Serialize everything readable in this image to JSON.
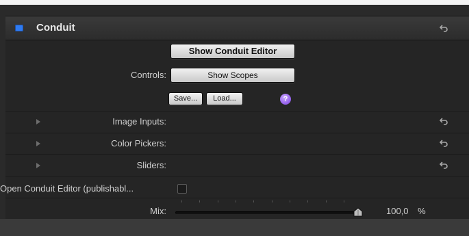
{
  "header": {
    "title": "Conduit"
  },
  "buttons": {
    "show_editor": "Show Conduit Editor",
    "show_scopes": "Show Scopes",
    "save": "Save...",
    "load": "Load...",
    "help": "?"
  },
  "labels": {
    "controls": "Controls:",
    "image_inputs": "Image Inputs:",
    "color_pickers": "Color Pickers:",
    "sliders": "Sliders:",
    "open_editor": "Open Conduit Editor (publishabl...",
    "mix": "Mix:"
  },
  "mix": {
    "value_text": "100,0",
    "unit": "%",
    "value": 100
  },
  "open_editor_checked": false,
  "colors": {
    "accent": "#2f7bf1",
    "help": "#8a4cf0"
  },
  "icons": [
    "reset-icon",
    "disclosure-triangle-icon",
    "help-icon",
    "enable-checkbox-icon"
  ]
}
